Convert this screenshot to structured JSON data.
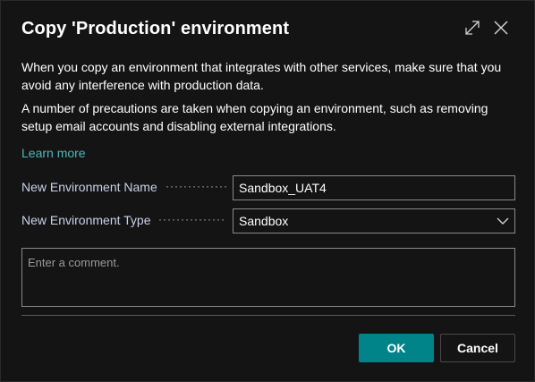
{
  "dialog": {
    "title": "Copy 'Production' environment",
    "expand_icon": "expand-icon",
    "close_icon": "close-icon"
  },
  "content": {
    "paragraph1": "When you copy an environment that integrates with other services, make sure that you avoid any interference with production data.",
    "paragraph2": "A number of precautions are taken when copying an environment, such as removing setup email accounts and disabling external integrations.",
    "learn_more": "Learn more"
  },
  "fields": {
    "name_label": "New Environment Name",
    "name_value": "Sandbox_UAT4",
    "type_label": "New Environment Type",
    "type_value": "Sandbox",
    "comment_placeholder": "Enter a comment."
  },
  "buttons": {
    "ok": "OK",
    "cancel": "Cancel"
  },
  "colors": {
    "accent": "#008489",
    "link": "#4fb8b8",
    "background": "#141414"
  }
}
